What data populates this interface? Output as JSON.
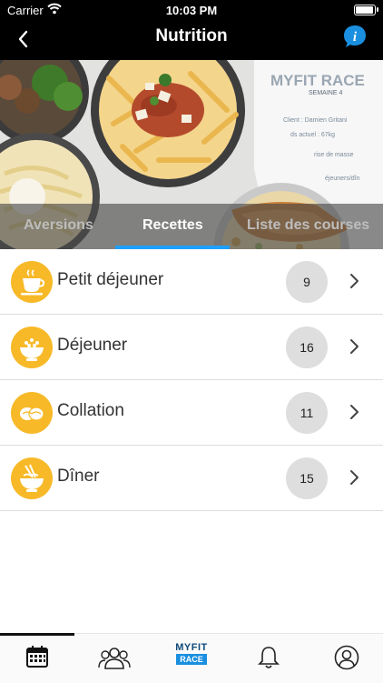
{
  "status_bar": {
    "carrier": "Carrier",
    "time": "10:03 PM"
  },
  "nav": {
    "title": "Nutrition"
  },
  "hero": {
    "brand_text": "MYFIT RACE",
    "week_label": "SEMAINE 4",
    "client_line": "Client : Damien Gritani",
    "weight_line": "ds actuel : 67kg",
    "goal_line": "rise de masse",
    "meal_line": "éjeuners/dîn"
  },
  "tabs": [
    {
      "label": "Aversions"
    },
    {
      "label": "Recettes"
    },
    {
      "label": "Liste des courses"
    }
  ],
  "categories": [
    {
      "label": "Petit déjeuner",
      "count": "9",
      "icon": "coffee-cup-icon"
    },
    {
      "label": "Déjeuner",
      "count": "16",
      "icon": "rice-bowl-icon"
    },
    {
      "label": "Collation",
      "count": "11",
      "icon": "snack-icon"
    },
    {
      "label": "Dîner",
      "count": "15",
      "icon": "noodle-bowl-icon"
    }
  ],
  "tab_bar": {
    "logo_top": "MYFIT",
    "logo_bottom": "RACE",
    "items": [
      "calendar-icon",
      "group-icon",
      "myfit-race-logo",
      "bell-icon",
      "profile-icon"
    ]
  },
  "colors": {
    "accent_orange": "#f7b928",
    "tab_indicator": "#1ea0ff",
    "nav_bg": "#000000",
    "info_blue": "#1a8fe0"
  }
}
